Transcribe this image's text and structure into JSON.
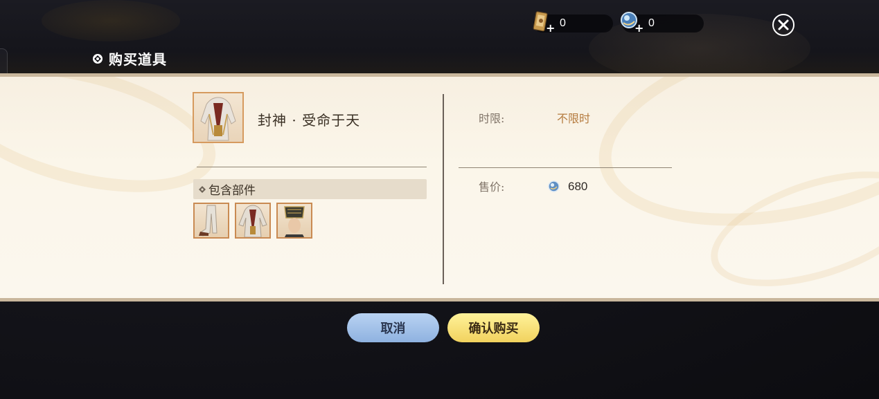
{
  "currencies": [
    {
      "icon": "scroll-ticket-icon",
      "plus": "+",
      "value": "0"
    },
    {
      "icon": "jade-orb-icon",
      "plus": "+",
      "value": "0"
    }
  ],
  "page_title": "购买道具",
  "item": {
    "name": "封神 · 受命于天"
  },
  "parts": {
    "header": "包含部件",
    "items": [
      "pants-part-icon",
      "robe-part-icon",
      "hat-part-icon"
    ]
  },
  "details": {
    "time_limit_label": "时限:",
    "time_limit_value": "不限时",
    "price_label": "售价:",
    "price_value": "680"
  },
  "buttons": {
    "cancel": "取消",
    "confirm": "确认购买"
  },
  "colors": {
    "accent_gold": "#b57b3e",
    "cancel_blue": "#9ebde6",
    "confirm_yellow": "#f6de72"
  }
}
